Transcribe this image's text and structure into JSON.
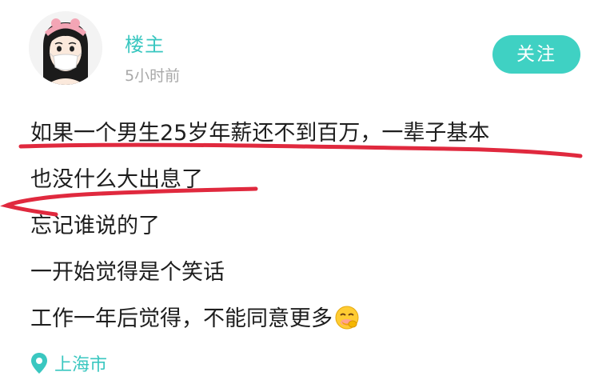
{
  "post": {
    "author": {
      "name": "楼主",
      "time": "5小时前",
      "avatar_icon": "cartoon-girl-mask-avatar"
    },
    "follow_label": "关注",
    "lines": [
      "如果一个男生25岁年薪还不到百万，一辈子基本",
      "也没什么大出息了",
      "忘记谁说的了",
      "一开始觉得是个笑话",
      "工作一年后觉得，不能同意更多"
    ],
    "emoji": "smirk-laugh-emoji",
    "location": "上海市",
    "location_icon": "map-pin-icon"
  },
  "colors": {
    "accent": "#3fd1c3",
    "accent_text": "#3ac7c0",
    "annotation": "#e0293e",
    "body_text": "#1e1e1e",
    "muted_text": "#a8a8a8"
  }
}
